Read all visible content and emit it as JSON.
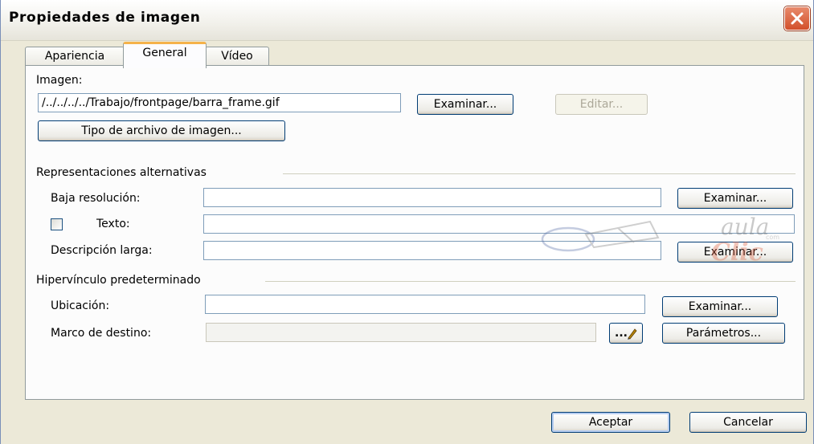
{
  "dialog": {
    "title": "Propiedades de imagen",
    "close_icon": "close-icon"
  },
  "tabs": [
    {
      "label": "Apariencia",
      "active": false
    },
    {
      "label": "General",
      "active": true
    },
    {
      "label": "Vídeo",
      "active": false
    }
  ],
  "image": {
    "label": "Imagen:",
    "path_value": "/../../../../Trabajo/frontpage/barra_frame.gif",
    "browse_label": "Examinar...",
    "edit_label": "Editar...",
    "file_type_label": "Tipo de archivo de imagen..."
  },
  "alternatives": {
    "group_label": "Representaciones alternativas",
    "low_res_label": "Baja resolución:",
    "low_res_value": "",
    "low_res_browse": "Examinar...",
    "text_label": "Texto:",
    "text_checked": false,
    "text_value": "",
    "long_desc_label": "Descripción larga:",
    "long_desc_value": "",
    "long_desc_browse": "Examinar..."
  },
  "hyperlink": {
    "group_label": "Hipervínculo predeterminado",
    "location_label": "Ubicación:",
    "location_value": "",
    "location_browse": "Examinar...",
    "target_label": "Marco de destino:",
    "target_value": "",
    "target_picker_label": "...",
    "params_label": "Parámetros..."
  },
  "footer": {
    "ok_label": "Aceptar",
    "cancel_label": "Cancelar"
  },
  "watermark": {
    "line1": "aula",
    "line2": "Clic",
    "small": "com"
  }
}
